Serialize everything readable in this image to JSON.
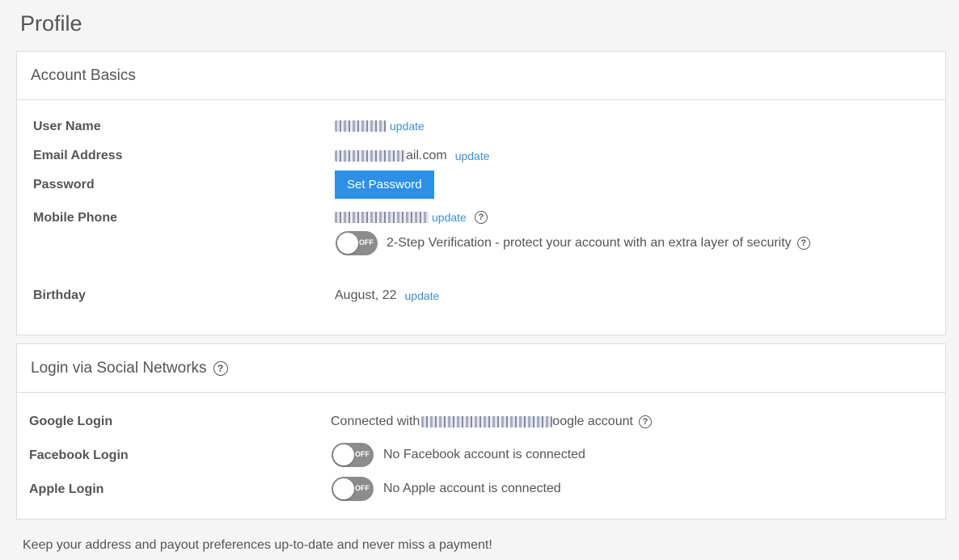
{
  "page_title": "Profile",
  "account": {
    "header": "Account Basics",
    "username": {
      "label": "User Name",
      "update": "update"
    },
    "email": {
      "label": "Email Address",
      "visible_suffix": "ail.com",
      "update": "update"
    },
    "password": {
      "label": "Password",
      "button": "Set Password"
    },
    "phone": {
      "label": "Mobile Phone",
      "update": "update"
    },
    "two_step": {
      "toggle": "OFF",
      "text": "2-Step Verification - protect your account with an extra layer of security"
    },
    "birthday": {
      "label": "Birthday",
      "value": "August, 22",
      "update": "update"
    }
  },
  "social": {
    "header": "Login via Social Networks",
    "google": {
      "label": "Google Login",
      "prefix": "Connected with",
      "suffix": "oogle account"
    },
    "facebook": {
      "label": "Facebook Login",
      "toggle": "OFF",
      "text": "No Facebook account is connected"
    },
    "apple": {
      "label": "Apple Login",
      "toggle": "OFF",
      "text": "No Apple account is connected"
    }
  },
  "footer_note": "Keep your address and payout preferences up-to-date and never miss a payment!",
  "colors": {
    "link": "#3b8fd8",
    "button": "#2d8fe6",
    "toggle_off": "#8c8c8c"
  }
}
